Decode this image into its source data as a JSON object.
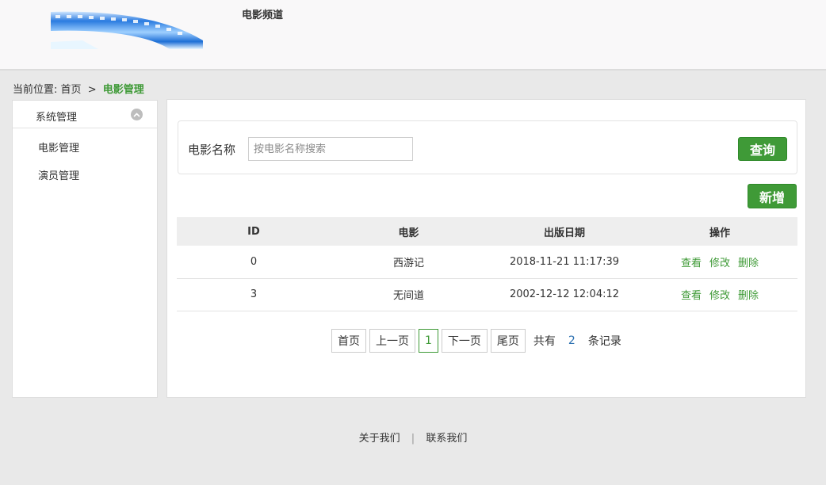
{
  "header": {
    "site_title": "电影频道"
  },
  "breadcrumb": {
    "prefix": "当前位置:",
    "home": "首页",
    "sep": ">",
    "current": "电影管理"
  },
  "sidebar": {
    "section_title": "系统管理",
    "items": [
      {
        "label": "电影管理"
      },
      {
        "label": "演员管理"
      }
    ]
  },
  "search": {
    "label": "电影名称",
    "placeholder": "按电影名称搜索",
    "value": "",
    "button": "查询"
  },
  "toolbar": {
    "add_label": "新增"
  },
  "table": {
    "headers": [
      "ID",
      "电影",
      "出版日期",
      "操作"
    ],
    "rows": [
      {
        "id": "0",
        "title": "西游记",
        "date": "2018-11-21 11:17:39"
      },
      {
        "id": "3",
        "title": "无间道",
        "date": "2002-12-12 12:04:12"
      }
    ],
    "actions": {
      "view": "查看",
      "edit": "修改",
      "delete": "删除"
    }
  },
  "pagination": {
    "first": "首页",
    "prev": "上一页",
    "current": "1",
    "next": "下一页",
    "last": "尾页",
    "total_prefix": "共有",
    "total": "2",
    "total_suffix": "条记录"
  },
  "footer": {
    "about": "关于我们",
    "divider": "|",
    "contact": "联系我们"
  },
  "colors": {
    "accent": "#3f9a37",
    "count_link": "#2a6fb0",
    "background": "#e9e9e9"
  }
}
